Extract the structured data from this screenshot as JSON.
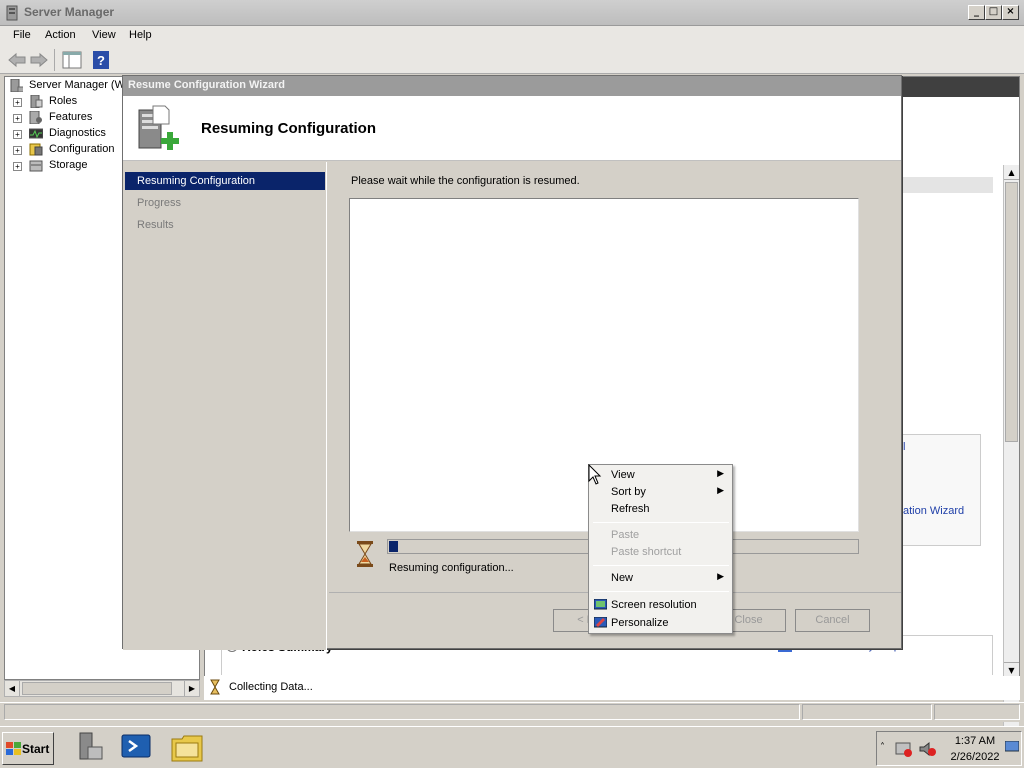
{
  "window": {
    "title": "Server Manager"
  },
  "menu": [
    "File",
    "Action",
    "View",
    "Help"
  ],
  "tree": {
    "root": "Server Manager (W",
    "items": [
      "Roles",
      "Features",
      "Diagnostics",
      "Configuration",
      "Storage"
    ]
  },
  "right_pane": {
    "link_fragment": "l",
    "wizard_link_fragment": "ation Wizard",
    "roles_summary": "Roles Summary",
    "roles_summary_help": "Roles Summary Help"
  },
  "status": {
    "collecting": "Collecting Data..."
  },
  "wizard": {
    "title": "Resume Configuration Wizard",
    "header_title": "Resuming Configuration",
    "nav": [
      "Resuming Configuration",
      "Progress",
      "Results"
    ],
    "wait_text": "Please wait while the configuration is resumed.",
    "progress_text": "Resuming configuration...",
    "progress_fraction": 0.02,
    "buttons": {
      "prev": "< Pre",
      "close": "Close",
      "cancel": "Cancel"
    }
  },
  "context_menu": {
    "view": "View",
    "sort_by": "Sort by",
    "refresh": "Refresh",
    "paste": "Paste",
    "paste_shortcut": "Paste shortcut",
    "new": "New",
    "screen_resolution": "Screen resolution",
    "personalize": "Personalize"
  },
  "taskbar": {
    "start": "Start",
    "time": "1:37 AM",
    "date": "2/26/2022"
  }
}
